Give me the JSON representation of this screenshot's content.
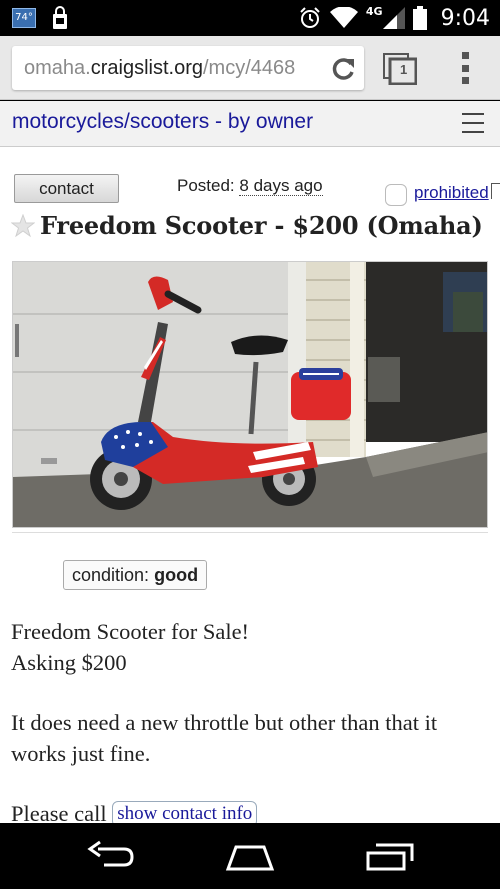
{
  "status_bar": {
    "temperature": "74°",
    "network": "4G",
    "time": "9:04",
    "icons": [
      "weather-icon",
      "shopping-bag-icon",
      "alarm-icon",
      "wifi-icon",
      "signal-icon",
      "battery-icon"
    ]
  },
  "browser": {
    "url_prefix": "omaha.",
    "url_domain": "craigslist.org",
    "url_path": "/mcy/4468",
    "tab_count": "1"
  },
  "breadcrumb": {
    "label": "motorcycles/scooters - by owner"
  },
  "posting": {
    "contact_label": "contact",
    "posted_prefix": "Posted:",
    "posted_ago": "8 days ago",
    "prohibited_label": "prohibited",
    "title": "Freedom Scooter - $200 (Omaha)",
    "condition_label": "condition:",
    "condition_value": "good",
    "body_line1": "Freedom Scooter for Sale!",
    "body_line2": "Asking $200",
    "body_para2": "It does need a new throttle but other than that it works just fine.",
    "call_text": "Please call",
    "show_contact_label": "show contact info"
  },
  "colors": {
    "link": "#1a1a9a",
    "header_bg": "#f2f2f2",
    "chrome_bg": "#e8e8e8"
  }
}
